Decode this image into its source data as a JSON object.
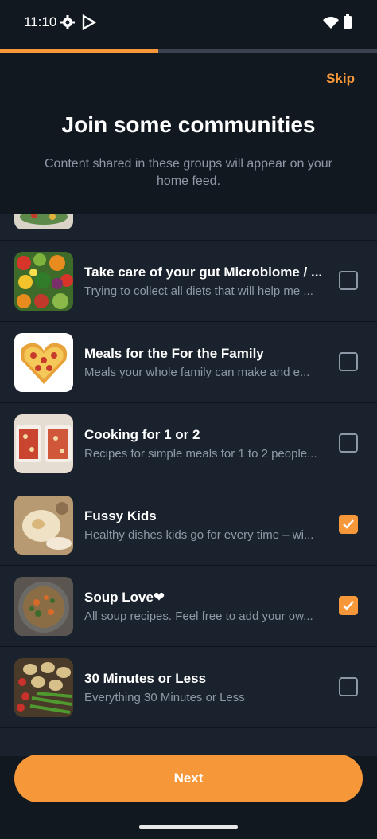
{
  "status_bar": {
    "time": "11:10",
    "icons": [
      "gear-icon",
      "play-store-icon",
      "wifi-icon",
      "battery-icon"
    ]
  },
  "progress": {
    "fraction": 0.42,
    "color": "#f6973a"
  },
  "header": {
    "skip_label": "Skip",
    "title": "Join some communities",
    "subtitle": "Content shared in these groups will appear on your home feed."
  },
  "communities": [
    {
      "title": "Take care of your gut Microbiome / ...",
      "description": "Trying to collect all diets that will help me ...",
      "checked": false,
      "thumbnail": "vegetables-thumbnail"
    },
    {
      "title": "Meals for the For the Family",
      "description": "Meals your whole family can make and e...",
      "checked": false,
      "thumbnail": "heart-pizza-thumbnail"
    },
    {
      "title": "Cooking for 1 or 2",
      "description": "Recipes for simple meals for 1 to 2 people...",
      "checked": false,
      "thumbnail": "baked-dishes-thumbnail"
    },
    {
      "title": "Fussy Kids",
      "description": "Healthy dishes kids go for every time – wi...",
      "checked": true,
      "thumbnail": "flatbread-thumbnail"
    },
    {
      "title": "Soup Love❤",
      "description": "All soup recipes. Feel free to add your ow...",
      "checked": true,
      "thumbnail": "soup-thumbnail"
    },
    {
      "title": "30 Minutes or Less",
      "description": "Everything 30 Minutes or Less",
      "checked": false,
      "thumbnail": "potatoes-beans-thumbnail"
    }
  ],
  "footer": {
    "next_label": "Next"
  },
  "colors": {
    "accent": "#f6973a",
    "background": "#111820",
    "list_background": "#1a222d",
    "muted_text": "#8e98a6"
  }
}
